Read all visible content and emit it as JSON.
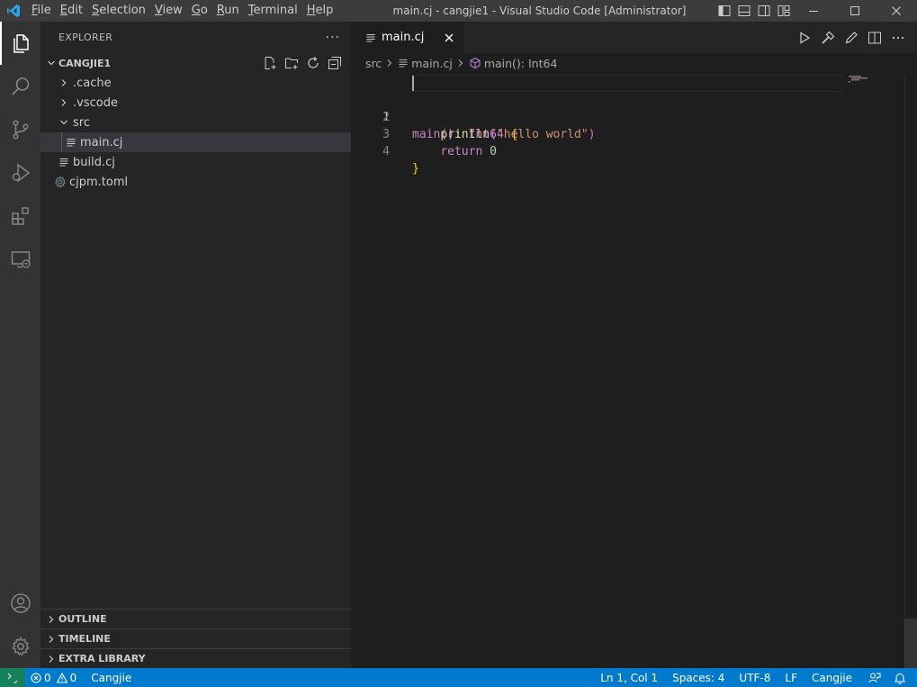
{
  "titlebar": {
    "window_title": "main.cj - cangjie1 - Visual Studio Code [Administrator]",
    "menu": [
      {
        "mn": "F",
        "rest": "ile"
      },
      {
        "mn": "E",
        "rest": "dit"
      },
      {
        "mn": "S",
        "rest": "election"
      },
      {
        "mn": "V",
        "rest": "iew"
      },
      {
        "mn": "G",
        "rest": "o"
      },
      {
        "mn": "R",
        "rest": "un"
      },
      {
        "mn": "T",
        "rest": "erminal"
      },
      {
        "mn": "H",
        "rest": "elp"
      }
    ]
  },
  "sidebar": {
    "title": "EXPLORER",
    "more": "···",
    "folder": "CANGJIE1",
    "tree": [
      {
        "label": ".cache",
        "kind": "folder-closed"
      },
      {
        "label": ".vscode",
        "kind": "folder-closed"
      },
      {
        "label": "src",
        "kind": "folder-open"
      },
      {
        "label": "main.cj",
        "kind": "file"
      },
      {
        "label": "build.cj",
        "kind": "file"
      },
      {
        "label": "cjpm.toml",
        "kind": "gear-file"
      }
    ],
    "sections": [
      "OUTLINE",
      "TIMELINE",
      "EXTRA LIBRARY"
    ]
  },
  "editor": {
    "tab_label": "main.cj",
    "breadcrumb": {
      "folder": "src",
      "file": "main.cj",
      "symbol": "main(): Int64"
    },
    "line_numbers": [
      "1",
      "2",
      "3",
      "4"
    ],
    "code": {
      "l1_fn": "main",
      "l1_paren": "()",
      "l1_colon": ": ",
      "l1_type": "Int64",
      "l1_brace": " {",
      "l2_indent": "    ",
      "l2_fn": "println",
      "l2_open": "(",
      "l2_str": "\"hello world\"",
      "l2_close": ")",
      "l3_indent": "    ",
      "l3_kw": "return",
      "l3_num": " 0",
      "l4_brace": "}"
    }
  },
  "statusbar": {
    "errors": "0",
    "warnings": "0",
    "language_left": "Cangjie",
    "position": "Ln 1, Col 1",
    "spaces": "Spaces: 4",
    "encoding": "UTF-8",
    "eol": "LF",
    "language_right": "Cangjie"
  },
  "colors": {
    "accent": "#007acc",
    "remote": "#16825d",
    "logo": "#23a9f2"
  }
}
